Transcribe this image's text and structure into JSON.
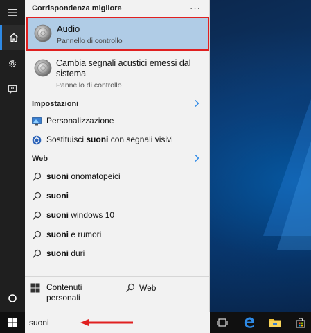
{
  "start_panel": {
    "best_match_heading": "Corrispondenza migliore",
    "more_options": "···",
    "best_match": {
      "title": "Audio",
      "subtitle": "Pannello di controllo",
      "icon": "speaker-icon"
    },
    "second_result": {
      "title": "Cambia segnali acustici emessi dal sistema",
      "subtitle": "Pannello di controllo",
      "icon": "speaker-icon"
    },
    "settings_heading": "Impostazioni",
    "settings_items": [
      {
        "label": "Personalizzazione",
        "icon": "personalization-icon"
      },
      {
        "prefix": "Sostituisci ",
        "bold": "suoni",
        "suffix": " con segnali visivi",
        "icon": "ease-of-access-icon"
      }
    ],
    "web_heading": "Web",
    "web_items": [
      {
        "bold": "suoni",
        "suffix": " onomatopeici"
      },
      {
        "bold": "suoni",
        "suffix": ""
      },
      {
        "bold": "suoni",
        "suffix": " windows 10"
      },
      {
        "bold": "suoni",
        "suffix": " e rumori"
      },
      {
        "bold": "suoni",
        "suffix": " duri"
      }
    ],
    "bottom": {
      "my_stuff": "Contenuti personali",
      "web": "Web"
    }
  },
  "left_rail": {
    "icons": [
      "hamburger-menu-icon",
      "home-icon",
      "settings-gear-icon",
      "feedback-icon",
      "cortana-circle-icon"
    ]
  },
  "taskbar": {
    "search_value": "suoni",
    "icons": [
      "windows-logo-icon",
      "task-view-icon",
      "edge-icon",
      "file-explorer-icon",
      "store-icon"
    ]
  },
  "colors": {
    "selection": "#b0cce6",
    "highlight_border": "#e02020",
    "accent": "#2e8ae6",
    "arrow": "#e02020"
  }
}
